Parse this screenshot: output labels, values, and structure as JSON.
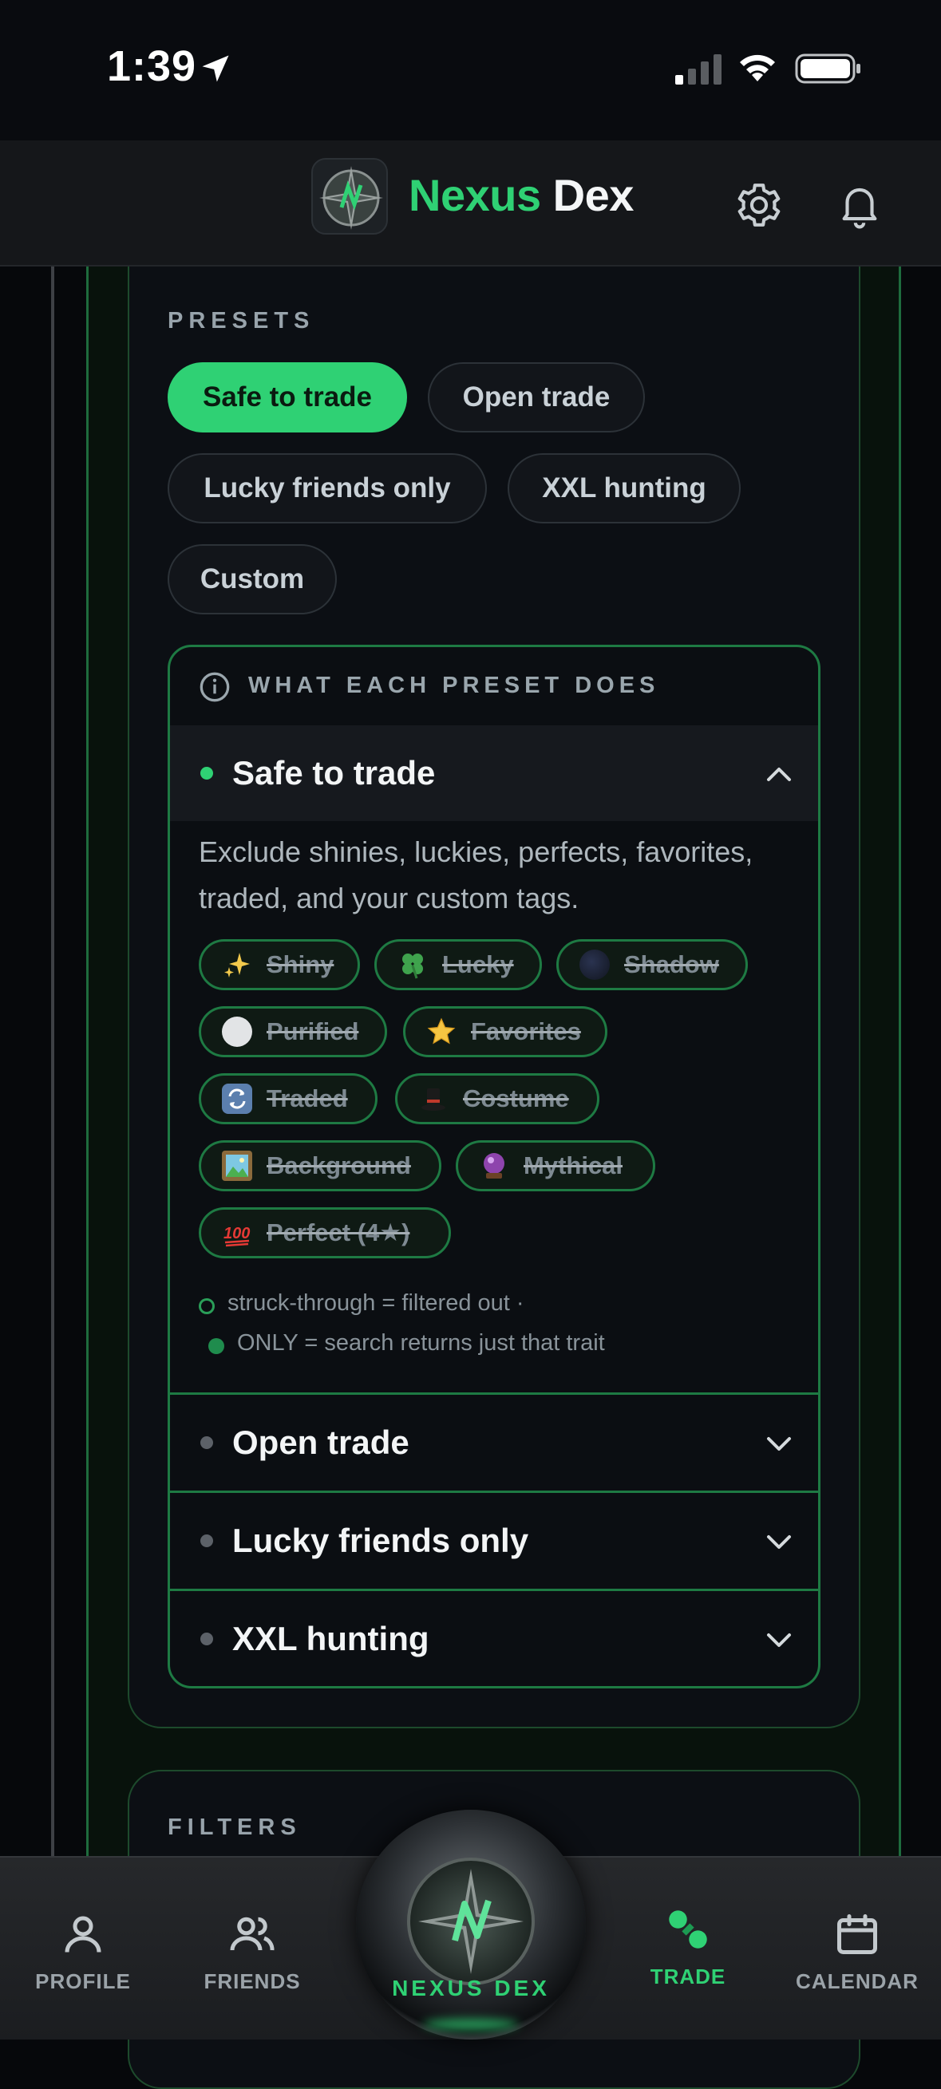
{
  "status_bar": {
    "time": "1:39"
  },
  "header": {
    "brand_part1": "Nexus",
    "brand_part2": "Dex"
  },
  "presets": {
    "section_title": "PRESETS",
    "chips": [
      {
        "label": "Safe to trade",
        "active": true
      },
      {
        "label": "Open trade",
        "active": false
      },
      {
        "label": "Lucky friends only",
        "active": false
      },
      {
        "label": "XXL hunting",
        "active": false
      },
      {
        "label": "Custom",
        "active": false
      }
    ]
  },
  "info_panel": {
    "title": "WHAT EACH PRESET DOES",
    "expanded": {
      "label": "Safe to trade",
      "description": "Exclude shinies, luckies, perfects, favorites, traded, and your custom tags.",
      "tags": [
        {
          "icon": "sparkles-icon",
          "label": "Shiny"
        },
        {
          "icon": "four-leaf-clover-icon",
          "label": "Lucky"
        },
        {
          "icon": "shadow-orb-icon",
          "label": "Shadow"
        },
        {
          "icon": "white-circle-icon",
          "label": "Purified"
        },
        {
          "icon": "star-icon",
          "label": "Favorites"
        },
        {
          "icon": "repeat-arrows-icon",
          "label": "Traded"
        },
        {
          "icon": "top-hat-icon",
          "label": "Costume"
        },
        {
          "icon": "framed-picture-icon",
          "label": "Background"
        },
        {
          "icon": "crystal-ball-icon",
          "label": "Mythical"
        },
        {
          "icon": "hundred-points-icon",
          "label": "Perfect (4★)"
        }
      ],
      "legend_line1": "struck-through = filtered out ·",
      "legend_line2": "ONLY  = search returns just that trait"
    },
    "collapsed": [
      {
        "label": "Open trade"
      },
      {
        "label": "Lucky friends only"
      },
      {
        "label": "XXL hunting"
      }
    ]
  },
  "filters": {
    "section_title": "FILTERS"
  },
  "bottom_nav": {
    "items": [
      {
        "label": "PROFILE",
        "icon": "person-icon"
      },
      {
        "label": "FRIENDS",
        "icon": "people-icon"
      },
      {
        "label": "NEXUS DEX",
        "icon": "nexus-orb-icon"
      },
      {
        "label": "TRADE",
        "icon": "trade-icon",
        "active": true
      },
      {
        "label": "CALENDAR",
        "icon": "calendar-icon"
      }
    ]
  },
  "colors": {
    "accent": "#2fd174",
    "background": "#06080b",
    "card": "#0c0f14",
    "border_green": "#1e7a43"
  }
}
